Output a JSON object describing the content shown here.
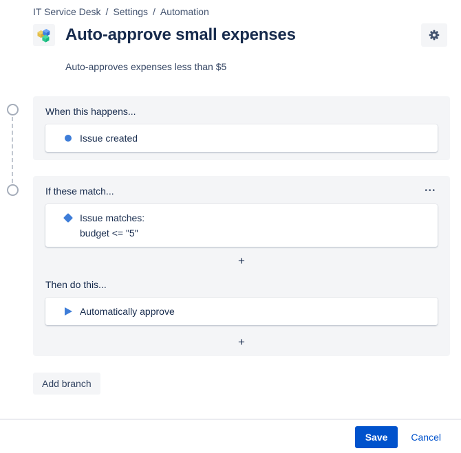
{
  "breadcrumb": {
    "items": [
      "IT Service Desk",
      "Settings",
      "Automation"
    ],
    "separator": "/"
  },
  "header": {
    "title": "Auto-approve small expenses",
    "subtitle": "Auto-approves expenses less than $5"
  },
  "sections": {
    "trigger": {
      "heading": "When this happens...",
      "card_label": "Issue created"
    },
    "condition": {
      "heading": "If these match...",
      "more_label": "•••",
      "card_lines": [
        "Issue matches:",
        "budget <= \"5\""
      ],
      "add_label": "+"
    },
    "action": {
      "heading": "Then do this...",
      "card_label": "Automatically approve",
      "add_label": "+"
    }
  },
  "add_branch_label": "Add branch",
  "footer": {
    "save_label": "Save",
    "cancel_label": "Cancel"
  },
  "colors": {
    "accent_blue": "#0052CC",
    "icon_blue": "#3E7DD8",
    "panel_gray": "#F4F5F7",
    "text_dark": "#172B4D",
    "text_slate": "#42526E",
    "rail_gray": "#C1C7D0"
  }
}
